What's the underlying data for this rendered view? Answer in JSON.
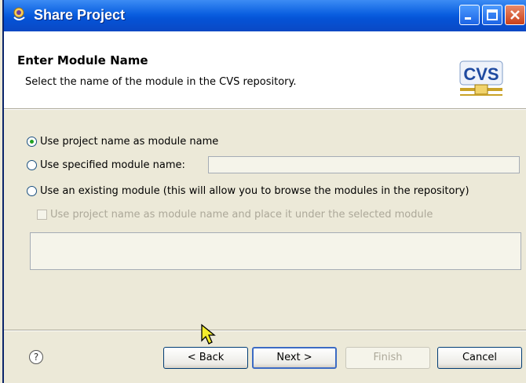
{
  "window": {
    "title": "Share Project"
  },
  "header": {
    "title": "Enter Module Name",
    "description": "Select the name of the module in the CVS repository.",
    "logo_text": "CVS"
  },
  "options": {
    "use_project_name": {
      "label": "Use project name as module name",
      "checked": true
    },
    "use_specified": {
      "label": "Use specified module name:",
      "checked": false,
      "value": ""
    },
    "use_existing": {
      "label": "Use an existing module (this will allow you to browse the modules in the repository)",
      "checked": false
    },
    "place_under": {
      "label": "Use project name as module name and place it under the selected module",
      "checked": false,
      "enabled": false
    }
  },
  "buttons": {
    "help": "?",
    "back": "< Back",
    "next": "Next >",
    "finish": "Finish",
    "cancel": "Cancel"
  },
  "colors": {
    "titlebar": "#0a5fe0",
    "radio_selected": "#21a121"
  }
}
